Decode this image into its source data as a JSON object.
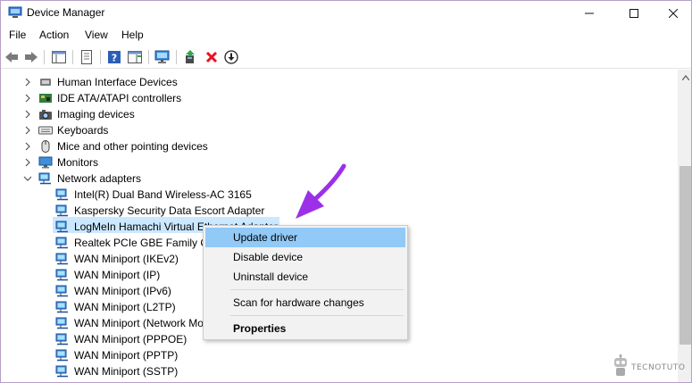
{
  "window": {
    "title": "Device Manager"
  },
  "menu": [
    "File",
    "Action",
    "View",
    "Help"
  ],
  "tree": {
    "categories": [
      {
        "label": "Human Interface Devices",
        "icon": "hid-icon"
      },
      {
        "label": "IDE ATA/ATAPI controllers",
        "icon": "ide-controller-icon"
      },
      {
        "label": "Imaging devices",
        "icon": "camera-icon"
      },
      {
        "label": "Keyboards",
        "icon": "keyboard-icon"
      },
      {
        "label": "Mice and other pointing devices",
        "icon": "mouse-icon"
      },
      {
        "label": "Monitors",
        "icon": "monitor-icon"
      },
      {
        "label": "Network adapters",
        "icon": "network-adapter-icon",
        "expanded": true
      }
    ],
    "network_adapters": [
      "Intel(R) Dual Band Wireless-AC 3165",
      "Kaspersky Security Data Escort Adapter",
      "LogMeIn Hamachi Virtual Ethernet Adapter",
      "Realtek PCIe GBE Family Controller",
      "WAN Miniport (IKEv2)",
      "WAN Miniport (IP)",
      "WAN Miniport (IPv6)",
      "WAN Miniport (L2TP)",
      "WAN Miniport (Network Monitor)",
      "WAN Miniport (PPPOE)",
      "WAN Miniport (PPTP)",
      "WAN Miniport (SSTP)"
    ],
    "selected_index": 2
  },
  "context_menu": {
    "update_driver": "Update driver",
    "disable_device": "Disable device",
    "uninstall_device": "Uninstall device",
    "scan": "Scan for hardware changes",
    "properties": "Properties"
  },
  "watermark": {
    "text": "TECNOTUTO"
  },
  "colors": {
    "selection": "#cce8ff",
    "menu_hover": "#91c9f7",
    "arrow": "#9b30e8",
    "uninstall_x": "#e81123"
  }
}
